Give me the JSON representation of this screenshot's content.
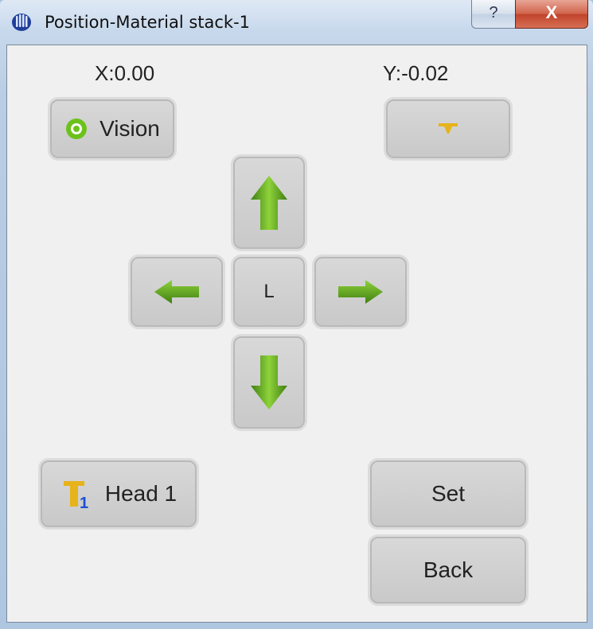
{
  "window": {
    "title": "Position-Material stack-1",
    "help_glyph": "?",
    "close_glyph": "X",
    "app_icon": "app-logo-icon"
  },
  "coords": {
    "x": "X:0.00",
    "y": "Y:-0.02"
  },
  "buttons": {
    "vision": "Vision",
    "nozzle_icon": "nozzle-icon",
    "up_icon": "arrow-up-icon",
    "left_icon": "arrow-left-icon",
    "center": "L",
    "right_icon": "arrow-right-icon",
    "down_icon": "arrow-down-icon",
    "head": "Head 1",
    "set": "Set",
    "back": "Back"
  },
  "colors": {
    "arrow_green": "#5a9a1e",
    "vision_green": "#6cc21a",
    "nozzle_gold": "#e7b31a",
    "head_badge_blue": "#1b4fd6"
  }
}
